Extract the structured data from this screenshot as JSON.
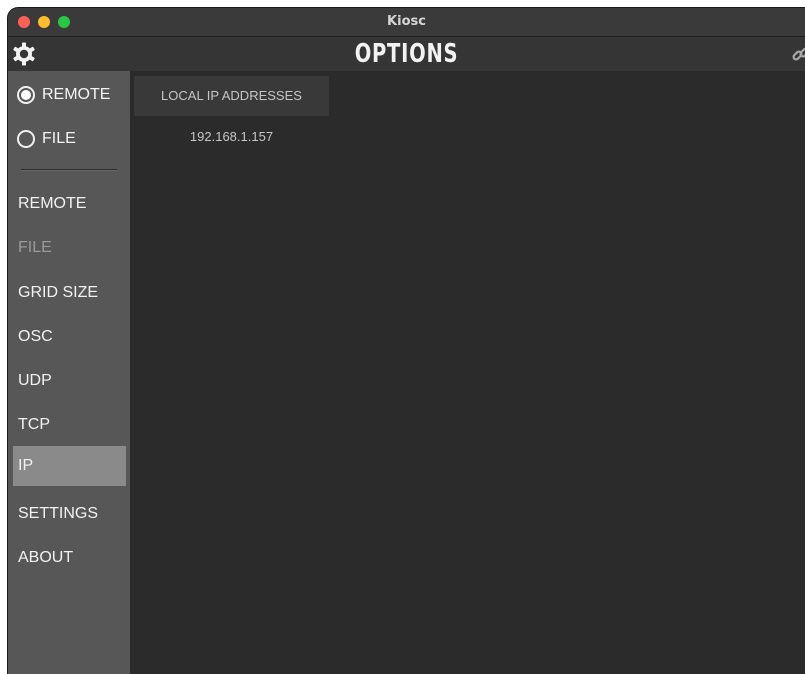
{
  "window": {
    "title": "Kiosc"
  },
  "header": {
    "title": "OPTIONS",
    "left_icon": "gear-icon",
    "right_icon": "link-icon"
  },
  "mode": {
    "options": [
      {
        "label": "REMOTE",
        "selected": true
      },
      {
        "label": "FILE",
        "selected": false
      }
    ]
  },
  "sidebar": {
    "items": [
      {
        "label": "REMOTE",
        "state": "normal"
      },
      {
        "label": "FILE",
        "state": "disabled"
      },
      {
        "label": "GRID SIZE",
        "state": "normal"
      },
      {
        "label": "OSC",
        "state": "normal"
      },
      {
        "label": "UDP",
        "state": "normal"
      },
      {
        "label": "TCP",
        "state": "normal"
      },
      {
        "label": "IP",
        "state": "active"
      },
      {
        "label": "SETTINGS",
        "state": "normal"
      },
      {
        "label": "ABOUT",
        "state": "normal"
      }
    ]
  },
  "main": {
    "section_title": "LOCAL IP ADDRESSES",
    "addresses": [
      "192.168.1.157"
    ]
  },
  "colors": {
    "sidebar_bg": "#575757",
    "active_item_bg": "#8a8a8a",
    "content_bg": "#2b2b2b",
    "close": "#ff5f57",
    "minimize": "#febc2e",
    "maximize": "#28c840"
  }
}
